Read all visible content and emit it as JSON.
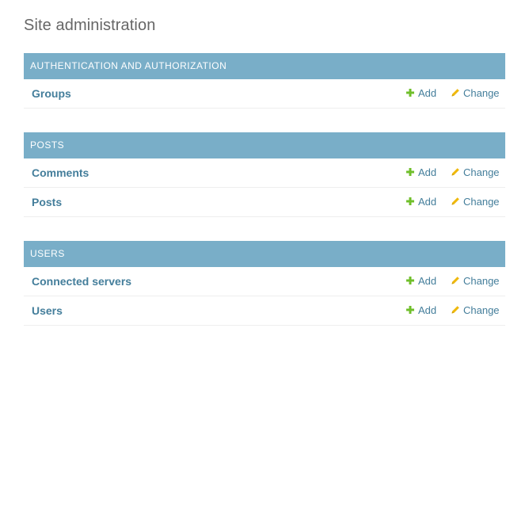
{
  "page": {
    "title": "Site administration"
  },
  "colors": {
    "module_header_bg": "#79aec8",
    "link": "#447e9b",
    "add_icon": "#70bf2b",
    "change_icon": "#efb80b"
  },
  "modules": [
    {
      "caption": "Authentication and Authorization",
      "models": [
        {
          "name": "Groups",
          "add_label": "Add",
          "change_label": "Change"
        }
      ]
    },
    {
      "caption": "Posts",
      "models": [
        {
          "name": "Comments",
          "add_label": "Add",
          "change_label": "Change"
        },
        {
          "name": "Posts",
          "add_label": "Add",
          "change_label": "Change"
        }
      ]
    },
    {
      "caption": "Users",
      "models": [
        {
          "name": "Connected servers",
          "add_label": "Add",
          "change_label": "Change"
        },
        {
          "name": "Users",
          "add_label": "Add",
          "change_label": "Change"
        }
      ]
    }
  ],
  "icons": {
    "add": "plus-icon",
    "change": "pencil-icon"
  }
}
